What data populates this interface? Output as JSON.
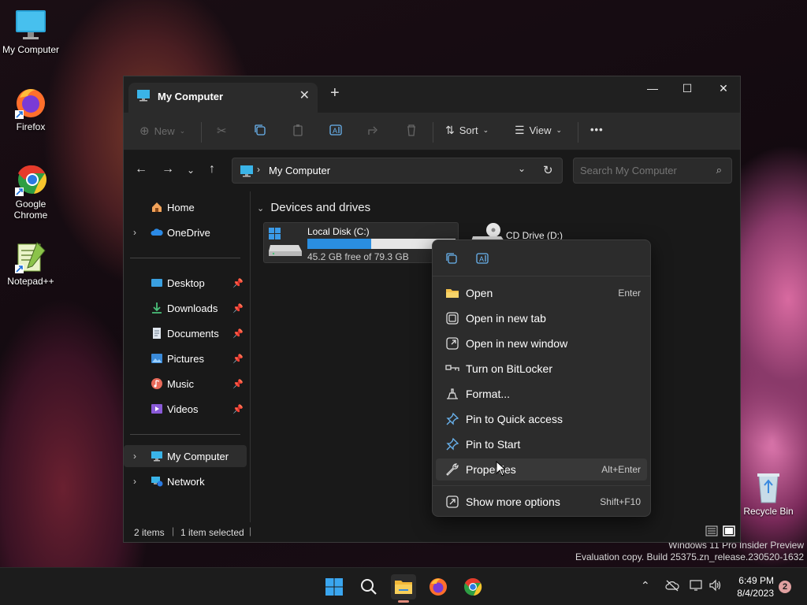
{
  "desktop": {
    "icons": [
      {
        "label": "My Computer",
        "icon": "monitor-icon"
      },
      {
        "label": "Firefox",
        "icon": "firefox-icon"
      },
      {
        "label": "Google Chrome",
        "icon": "chrome-icon"
      },
      {
        "label": "Notepad++",
        "icon": "notepadpp-icon"
      },
      {
        "label": "Recycle Bin",
        "icon": "recycle-bin-icon"
      }
    ],
    "watermark_line1": "Windows 11 Pro Insider Preview",
    "watermark_line2": "Evaluation copy. Build 25375.zn_release.230520-1632"
  },
  "window": {
    "tab_title": "My Computer",
    "new_tab_label": "+",
    "controls": {
      "minimize": "—",
      "maximize": "☐",
      "close": "✕"
    }
  },
  "command_bar": {
    "new_label": "New",
    "sort_label": "Sort",
    "view_label": "View",
    "more_label": "•••"
  },
  "address": {
    "path": "My Computer",
    "search_placeholder": "Search My Computer"
  },
  "sidebar": {
    "items": [
      {
        "label": "Home",
        "icon": "home-icon"
      },
      {
        "label": "OneDrive",
        "icon": "cloud-icon"
      },
      {
        "label": "Desktop",
        "icon": "desktop-folder-icon"
      },
      {
        "label": "Downloads",
        "icon": "download-icon"
      },
      {
        "label": "Documents",
        "icon": "document-icon"
      },
      {
        "label": "Pictures",
        "icon": "pictures-icon"
      },
      {
        "label": "Music",
        "icon": "music-icon"
      },
      {
        "label": "Videos",
        "icon": "videos-icon"
      },
      {
        "label": "My Computer",
        "icon": "monitor-icon"
      },
      {
        "label": "Network",
        "icon": "network-icon"
      }
    ]
  },
  "content": {
    "group_label": "Devices and drives",
    "drives": [
      {
        "name": "Local Disk (C:)",
        "free_text": "45.2 GB free of 79.3 GB",
        "used_fraction": 0.43
      },
      {
        "name": "CD Drive (D:)"
      }
    ]
  },
  "status": {
    "items_count": "2 items",
    "selected": "1 item selected"
  },
  "context_menu": {
    "items": [
      {
        "label": "Open",
        "shortcut": "Enter",
        "icon": "folder-open-icon"
      },
      {
        "label": "Open in new tab",
        "shortcut": "",
        "icon": "new-tab-icon"
      },
      {
        "label": "Open in new window",
        "shortcut": "",
        "icon": "new-window-icon"
      },
      {
        "label": "Turn on BitLocker",
        "shortcut": "",
        "icon": "key-icon"
      },
      {
        "label": "Format...",
        "shortcut": "",
        "icon": "format-icon"
      },
      {
        "label": "Pin to Quick access",
        "shortcut": "",
        "icon": "pin-icon"
      },
      {
        "label": "Pin to Start",
        "shortcut": "",
        "icon": "pin-icon"
      },
      {
        "label": "Properties",
        "shortcut": "Alt+Enter",
        "icon": "wrench-icon"
      },
      {
        "label": "Show more options",
        "shortcut": "Shift+F10",
        "icon": "more-options-icon"
      }
    ]
  },
  "taskbar": {
    "time": "6:49 PM",
    "date": "8/4/2023",
    "notification_count": "2"
  }
}
